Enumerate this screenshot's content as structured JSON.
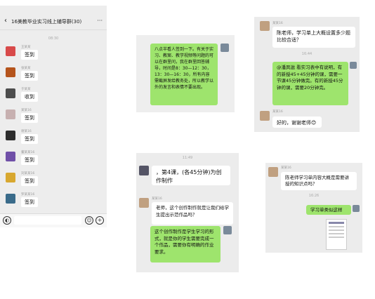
{
  "colors": {
    "bubble_green": "#9ee46d",
    "panel_bg": "#ececec",
    "bubble_white": "#ffffff"
  },
  "chat1": {
    "title": "16美教毕业实习线上辅导群(30)",
    "time": "08:30",
    "status_bar": "",
    "messages": [
      {
        "name": "王某某",
        "text": "签到",
        "avatar_color": "#d84a4a"
      },
      {
        "name": "张某某",
        "text": "签到",
        "avatar_color": "#b5541c"
      },
      {
        "name": "于某某",
        "text": "收到",
        "avatar_color": "#4d4d4d"
      },
      {
        "name": "某某16",
        "text": "签到",
        "avatar_color": "#c7b0b0"
      },
      {
        "name": "谢某16",
        "text": "签到",
        "avatar_color": "#2d2d2d"
      },
      {
        "name": "董某某16",
        "text": "签到",
        "avatar_color": "#7050a8"
      },
      {
        "name": "刘某某16",
        "text": "签到",
        "avatar_color": "#d8a830"
      },
      {
        "name": "罗某某16",
        "text": "签到",
        "avatar_color": "#3a6b8a"
      }
    ],
    "icons": [
      "voice-icon",
      "emoji-icon",
      "plus-icon"
    ]
  },
  "chat2": {
    "message": "八点半看人签到一下。有关于实习、教案、教学视频等问题的可以在群里问，我在群里回答辅导，时间是8：30—12：30，13：30—16：30，所有内容需截屏发给教务处，所以教学以外的发言和表情不要出现。"
  },
  "chat3": {
    "name_top": "某某16",
    "q1": "陈老师，学习单上大概设置多少题比较合适？",
    "time": "16:44",
    "answer": "@潘凤滋 看实习表中有说明，有的新授45+45分钟的课，需要一节课45分钟做完。有的新授45分钟的课，需要20分钟完。",
    "name_bottom": "某某16",
    "thanks": "好的，谢谢老师😊"
  },
  "chat4": {
    "time": "11:49",
    "partial": "，第4课，(各45分钟)为创作制作",
    "name": "某某16",
    "question": "老师，这个创作制作就是让我们给学生提出示范作品吗？",
    "answer": "这个创作制作是学生学习的形式，就是你的学生需要完成一个作品，需要你有明确的作业要求。"
  },
  "chat5": {
    "name": "某某16",
    "question": "陈老师学习单内容大概是需要讲授的知识点吗？",
    "time": "16:26",
    "answer": "学习单类似这样"
  }
}
